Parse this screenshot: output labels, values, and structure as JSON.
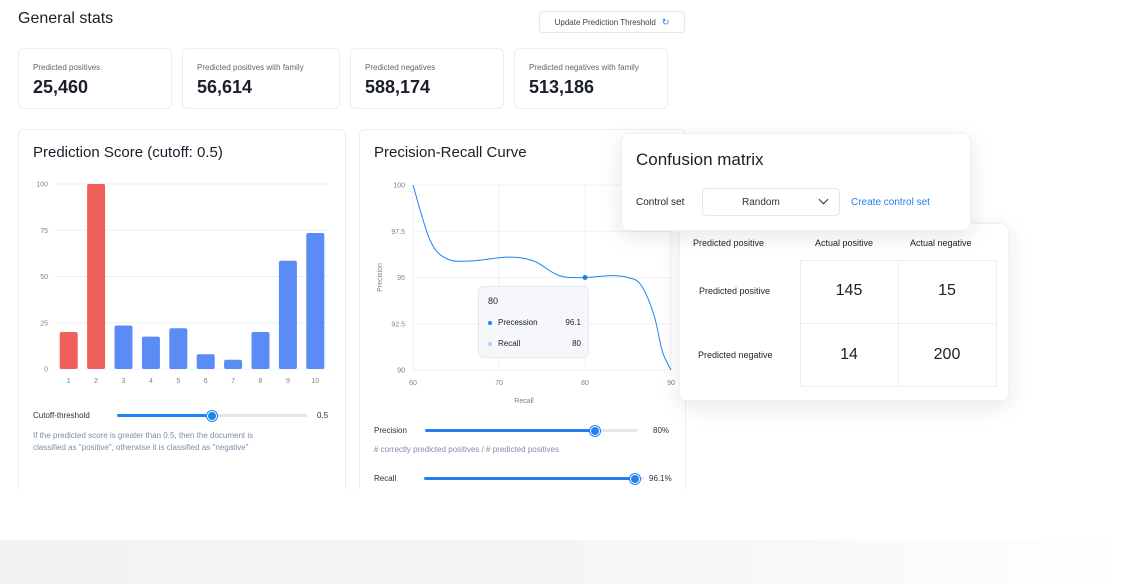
{
  "header": {
    "title": "General stats",
    "update_button": "Update Prediction Threshold",
    "update_icon": "refresh-icon"
  },
  "stats": [
    {
      "label": "Predicted positives",
      "value": "25,460"
    },
    {
      "label": "Predicted positives with family",
      "value": "56,614"
    },
    {
      "label": "Predicted negatives",
      "value": "588,174"
    },
    {
      "label": "Predicted negatives with family",
      "value": "513,186"
    }
  ],
  "score_panel": {
    "title": "Prediction Score (cutoff: 0.5)",
    "slider_label": "Cutoff-threshold",
    "slider_value": "0.5",
    "slider_fraction": 0.5,
    "help_text_line1": "If the predicted score is greater than 0.5, then the document is",
    "help_text_line2": "classified as \"positive\", otherwise it is classified as \"negative\""
  },
  "pr_panel": {
    "title": "Precision-Recall Curve",
    "precision_label": "Precision",
    "precision_value": "80%",
    "precision_fraction": 0.8,
    "precision_help": "# correctly predicted positives / # predicted positives",
    "recall_label": "Recall",
    "recall_value": "96.1%",
    "recall_fraction": 0.961,
    "tooltip": {
      "title": "80",
      "rows": [
        {
          "label": "Precession",
          "value": "96.1",
          "color": "#1f82f0"
        },
        {
          "label": "Recall",
          "value": "80",
          "color": "#a9d0fb"
        }
      ]
    }
  },
  "confusion": {
    "title": "Confusion matrix",
    "control_label": "Control set",
    "select_value": "Random",
    "create_link": "Create control set",
    "corner_label": "Predicted positive",
    "col_headers": [
      "Actual positive",
      "Actual negative"
    ],
    "rows": [
      {
        "label": "Predicted positive",
        "values": [
          "145",
          "15"
        ]
      },
      {
        "label": "Predicted negative",
        "values": [
          "14",
          "200"
        ]
      }
    ]
  },
  "chart_data": [
    {
      "type": "bar",
      "title": "Prediction Score (cutoff: 0.5)",
      "categories": [
        "1",
        "2",
        "3",
        "4",
        "5",
        "6",
        "7",
        "8",
        "9",
        "10"
      ],
      "values": [
        20,
        100,
        23.5,
        17.5,
        22,
        8,
        5,
        20,
        58.5,
        73.5
      ],
      "colors": [
        "#f0605a",
        "#f0605a",
        "#5b8bf5",
        "#5b8bf5",
        "#5b8bf5",
        "#5b8bf5",
        "#5b8bf5",
        "#5b8bf5",
        "#5b8bf5",
        "#5b8bf5"
      ],
      "yticks": [
        "0",
        "25",
        "50",
        "75",
        "100"
      ],
      "ylim": [
        0,
        100
      ],
      "grid": true,
      "legend": "none"
    },
    {
      "type": "line",
      "title": "Precision-Recall Curve",
      "xlabel": "Recall",
      "ylabel": "Precision",
      "xticks": [
        "60",
        "70",
        "80",
        "90"
      ],
      "yticks": [
        "90",
        "92.5",
        "95",
        "97.5",
        "100"
      ],
      "xlim": [
        60,
        90
      ],
      "ylim": [
        90,
        100
      ],
      "series": [
        {
          "color": "#1f82f0",
          "x": [
            60,
            62,
            64,
            67,
            71,
            74,
            77,
            80,
            83,
            85,
            86.5,
            88,
            89,
            90
          ],
          "y": [
            100,
            97,
            96,
            95.9,
            96.1,
            95.9,
            95.1,
            95.0,
            95.1,
            95.0,
            94.6,
            93,
            91,
            90
          ]
        }
      ],
      "highlight": {
        "x": 80,
        "y": 95.0
      },
      "grid": true
    }
  ]
}
